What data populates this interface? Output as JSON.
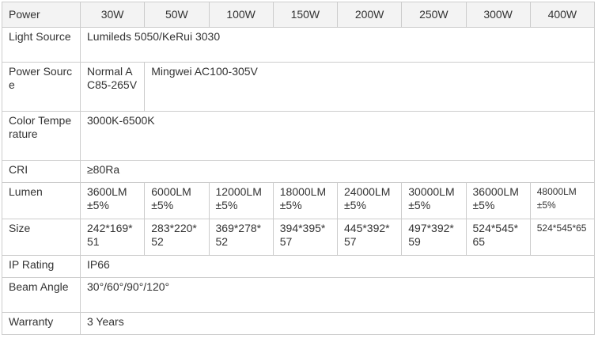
{
  "table": {
    "header": [
      "Power",
      "30W",
      "50W",
      "100W",
      "150W",
      "200W",
      "250W",
      "300W",
      "400W"
    ],
    "light_source": {
      "label": "Light Source",
      "value": "Lumileds 5050/KeRui 3030"
    },
    "power_source": {
      "label": "Power Source",
      "normal": "Normal AC85-265V",
      "value": "Mingwei AC100-305V"
    },
    "color_temperature": {
      "label": "Color Temperature",
      "value": "3000K-6500K"
    },
    "cri": {
      "label": "CRI",
      "value": "≥80Ra"
    },
    "lumen": {
      "label": "Lumen",
      "values": [
        "3600LM ±5%",
        "6000LM ±5%",
        "12000LM±5%",
        "18000LM±5%",
        "24000LM±5%",
        "30000LM±5%",
        "36000LM±5%",
        "48000LM±5%"
      ]
    },
    "size": {
      "label": "Size",
      "values": [
        "242*169*51",
        "283*220*52",
        "369*278*52",
        "394*395*57",
        "445*392*57",
        "497*392*59",
        "524*545*65",
        "524*545*65"
      ]
    },
    "ip_rating": {
      "label": "IP Rating",
      "value": "IP66"
    },
    "beam_angle": {
      "label": "Beam Angle",
      "value": "30°/60°/90°/120°"
    },
    "warranty": {
      "label": "Warranty",
      "value": "3 Years"
    }
  }
}
